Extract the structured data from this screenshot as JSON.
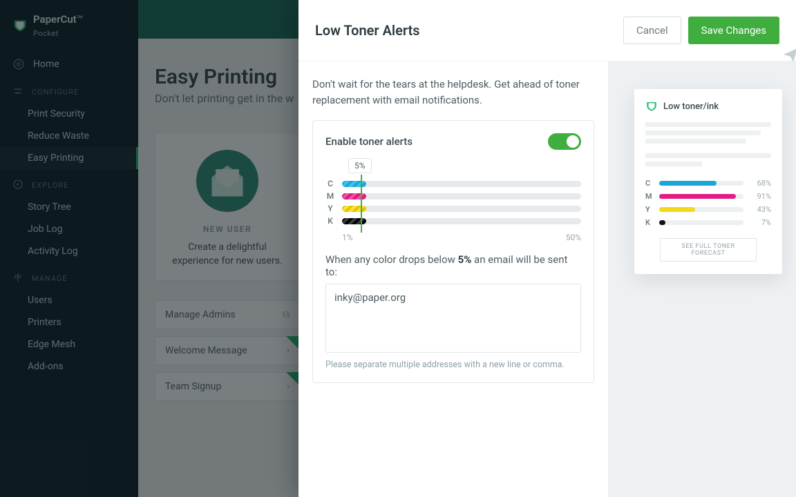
{
  "brand": {
    "line1": "PaperCut",
    "line2": "Pocket"
  },
  "nav": {
    "home": "Home",
    "sections": {
      "configure": {
        "label": "CONFIGURE",
        "items": [
          "Print Security",
          "Reduce Waste",
          "Easy Printing"
        ]
      },
      "explore": {
        "label": "EXPLORE",
        "items": [
          "Story Tree",
          "Job Log",
          "Activity Log"
        ]
      },
      "manage": {
        "label": "MANAGE",
        "items": [
          "Users",
          "Printers",
          "Edge Mesh",
          "Add-ons"
        ]
      }
    }
  },
  "page": {
    "title": "Easy Printing",
    "subtitle": "Don't let printing get in the w",
    "card": {
      "title": "NEW USER",
      "body": "Create a delightful experience for new users."
    },
    "tiles": [
      "Manage Admins",
      "Welcome Message",
      "Team Signup"
    ]
  },
  "panel": {
    "title": "Low Toner Alerts",
    "cancel": "Cancel",
    "save": "Save Changes",
    "intro": "Don't wait for the tears at the helpdesk. Get ahead of toner replacement with email notifications.",
    "toggleLabel": "Enable toner alerts",
    "threshold": "5%",
    "tooltip": "5%",
    "range": {
      "min": "1%",
      "max": "50%"
    },
    "bars": [
      "C",
      "M",
      "Y",
      "K"
    ],
    "sentenceA": "When any color drops below ",
    "sentenceB": " an email will be sent to:",
    "emails": "inky@paper.org",
    "helper": "Please separate multiple addresses with a new line or comma."
  },
  "preview": {
    "title": "Low toner/ink",
    "rows": [
      {
        "label": "C",
        "pct": "68%",
        "color": "#1aa6d8",
        "width": "68%"
      },
      {
        "label": "M",
        "pct": "91%",
        "color": "#e21d87",
        "width": "91%"
      },
      {
        "label": "Y",
        "pct": "43%",
        "color": "#f3d81b",
        "width": "43%"
      },
      {
        "label": "K",
        "pct": "7%",
        "color": "#111",
        "width": "7%"
      }
    ],
    "forecast": "SEE FULL TONER FORECAST"
  }
}
